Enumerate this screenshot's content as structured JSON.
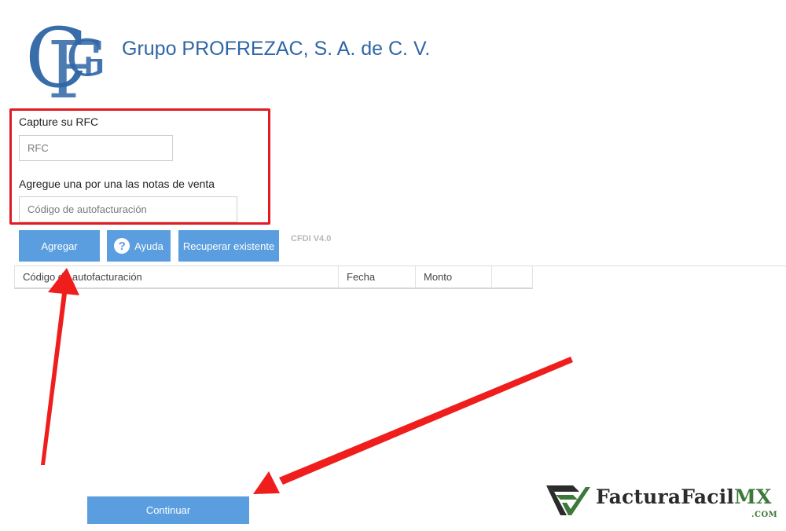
{
  "header": {
    "logo_letters": "CFG",
    "company_name": "Grupo PROFREZAC, S. A. de C. V."
  },
  "form": {
    "rfc_label": "Capture su RFC",
    "rfc_placeholder": "RFC",
    "rfc_value": "",
    "notes_label": "Agregue una por una las notas de venta",
    "code_placeholder": "Código de autofacturación",
    "code_value": ""
  },
  "buttons": {
    "add": "Agregar",
    "help": "Ayuda",
    "help_icon": "?",
    "recover": "Recuperar existente",
    "continue": "Continuar"
  },
  "version_label": "CFDI V4.0",
  "table": {
    "columns": [
      "Código de autofacturación",
      "Fecha",
      "Monto",
      ""
    ],
    "rows": []
  },
  "watermark": {
    "brand_main": "FacturaFacil",
    "brand_mx": "MX",
    "brand_suffix": ".COM"
  },
  "colors": {
    "accent": "#5b9ee0",
    "highlight": "#e11b22",
    "arrow": "#f01d1d",
    "company_text": "#2f66a5"
  },
  "icons": {
    "help": "question-circle-icon",
    "annotation": "red-arrow-icon"
  }
}
